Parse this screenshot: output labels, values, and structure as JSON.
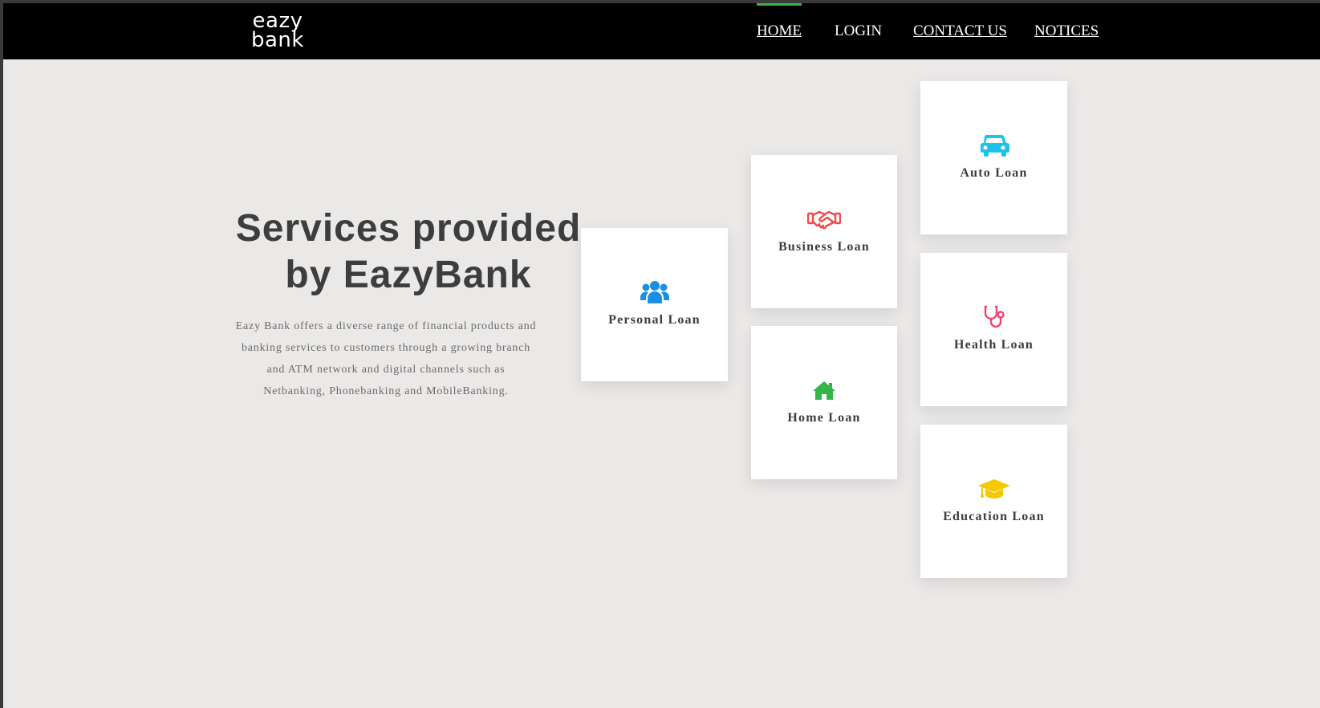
{
  "brand": {
    "logo_line1": "eazy",
    "logo_line2": "bank"
  },
  "nav": {
    "home": "HOME",
    "login": "LOGIN",
    "contact": "CONTACT US",
    "notices": "NOTICES",
    "active_item": "HOME",
    "active_color": "#3fb34a"
  },
  "hero": {
    "title_line1": "Services provided",
    "title_line2": "by EazyBank",
    "description_lines": [
      "Eazy Bank offers a diverse range of financial products and",
      "banking services to customers through a growing branch",
      "and ATM network and digital channels such as",
      "Netbanking, Phonebanking and MobileBanking."
    ]
  },
  "services": [
    {
      "label": "Personal Loan",
      "icon": "users-icon",
      "color": "#1a8fe3"
    },
    {
      "label": "Business Loan",
      "icon": "handshake-icon",
      "color": "#ef4b4b"
    },
    {
      "label": "Home Loan",
      "icon": "home-icon",
      "color": "#33b54a"
    },
    {
      "label": "Auto Loan",
      "icon": "car-icon",
      "color": "#19c3ea"
    },
    {
      "label": "Health Loan",
      "icon": "stethoscope-icon",
      "color": "#f0436e"
    },
    {
      "label": "Education Loan",
      "icon": "graduation-cap-icon",
      "color": "#f4c900"
    }
  ],
  "colors": {
    "page_background": "#ebe9e8",
    "navbar_background": "#000000",
    "heading_text": "#3d3d3d",
    "body_text": "#6a6a6a"
  }
}
